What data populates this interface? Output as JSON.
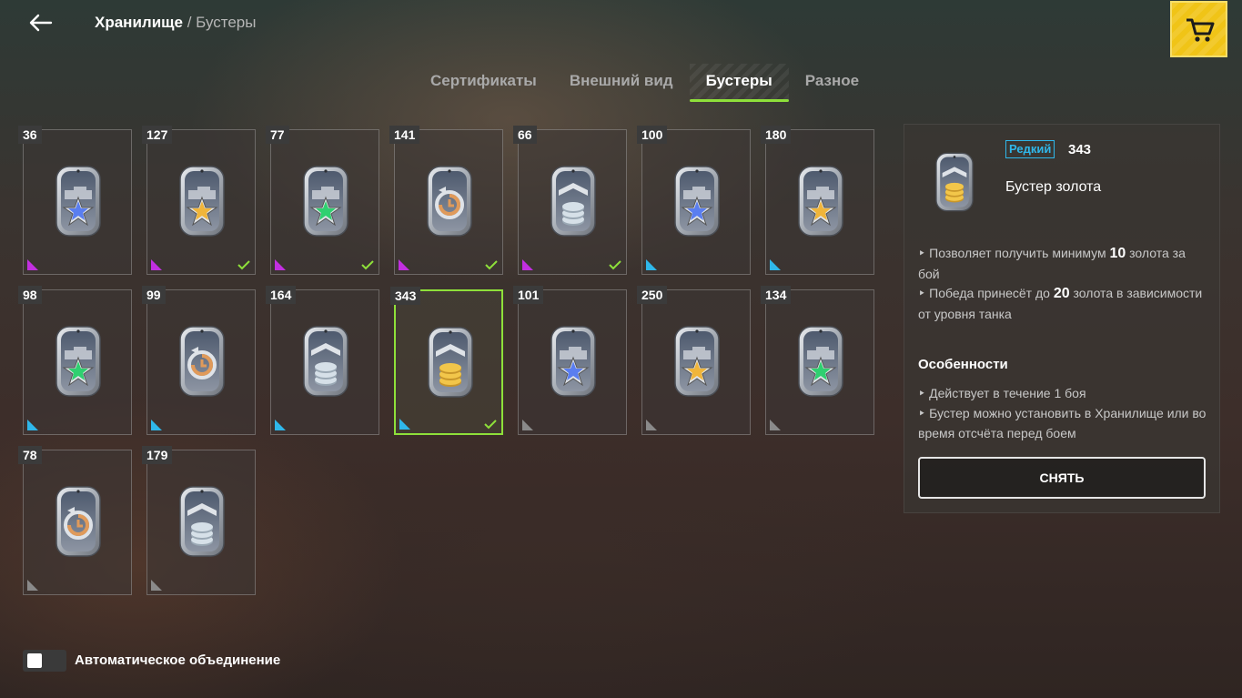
{
  "header": {
    "breadcrumb_main": "Хранилище",
    "breadcrumb_sep": "/",
    "breadcrumb_sub": "Бустеры",
    "back_icon": "arrow-left-icon",
    "shop_icon": "cart-icon",
    "shop_color": "#f0c417"
  },
  "tabs": [
    {
      "label": "Сертификаты",
      "active": false
    },
    {
      "label": "Внешний вид",
      "active": false
    },
    {
      "label": "Бустеры",
      "active": true
    },
    {
      "label": "Разное",
      "active": false
    }
  ],
  "boosters": [
    {
      "count": "36",
      "icon": "star-blue",
      "rarity": "purple",
      "checked": false
    },
    {
      "count": "127",
      "icon": "star-gold",
      "rarity": "purple",
      "checked": true
    },
    {
      "count": "77",
      "icon": "star-green",
      "rarity": "purple",
      "checked": true
    },
    {
      "count": "141",
      "icon": "clock",
      "rarity": "purple",
      "checked": true
    },
    {
      "count": "66",
      "icon": "coins-silver",
      "rarity": "purple",
      "checked": true
    },
    {
      "count": "100",
      "icon": "star-blue",
      "rarity": "blue",
      "checked": false
    },
    {
      "count": "180",
      "icon": "star-gold",
      "rarity": "blue",
      "checked": false
    },
    {
      "count": "98",
      "icon": "star-green",
      "rarity": "blue",
      "checked": false
    },
    {
      "count": "99",
      "icon": "clock",
      "rarity": "blue",
      "checked": false
    },
    {
      "count": "164",
      "icon": "coins-silver",
      "rarity": "blue",
      "checked": false
    },
    {
      "count": "343",
      "icon": "coins-gold",
      "rarity": "blue",
      "checked": true,
      "selected": true
    },
    {
      "count": "101",
      "icon": "star-blue",
      "rarity": "gray",
      "checked": false
    },
    {
      "count": "250",
      "icon": "star-gold",
      "rarity": "gray",
      "checked": false
    },
    {
      "count": "134",
      "icon": "star-green",
      "rarity": "gray",
      "checked": false
    },
    {
      "count": "78",
      "icon": "clock",
      "rarity": "gray",
      "checked": false
    },
    {
      "count": "179",
      "icon": "coins-silver",
      "rarity": "gray",
      "checked": false
    }
  ],
  "rarity_colors": {
    "purple": "#c22fe0",
    "blue": "#2fb7ea",
    "gray": "#8a8a8a"
  },
  "detail": {
    "rarity": "Редкий",
    "count": "343",
    "title": "Бустер золота",
    "desc1_pre": "Позволяет получить минимум ",
    "desc1_num": "10",
    "desc1_post": " золота за бой",
    "desc2_pre": "Победа принесёт до ",
    "desc2_num": "20",
    "desc2_post": " золота в зависимости от уровня танка",
    "features_title": "Особенности",
    "feature1": "Действует в течение 1 боя",
    "feature2": "Бустер можно установить в Хранилище или во время отсчёта перед боем",
    "button": "СНЯТЬ"
  },
  "auto_merge": {
    "label": "Автоматическое объединение",
    "enabled": false
  }
}
